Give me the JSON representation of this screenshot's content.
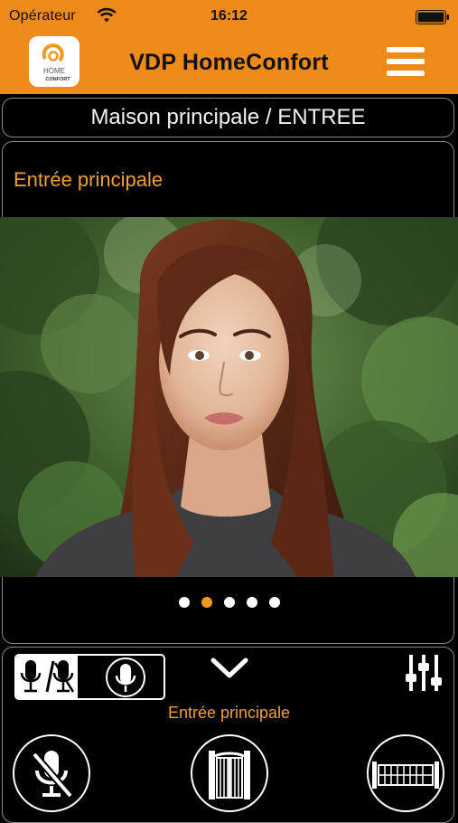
{
  "status_bar": {
    "carrier": "Opérateur",
    "time": "16:12"
  },
  "header": {
    "title": "VDP HomeConfort",
    "logo": {
      "line1": "HOME",
      "line2": "CONFORT"
    },
    "accent_color": "#ee8a1a"
  },
  "location": {
    "path": "Maison principale / ENTREE"
  },
  "camera": {
    "name": "Entrée principale",
    "name_color": "#f0a033",
    "pages": {
      "count": 5,
      "active_index": 1
    }
  },
  "controls": {
    "label": "Entrée principale",
    "icons": {
      "audio_mode": [
        "microphone-icon",
        "microphone-muted-icon",
        "microphone-icon"
      ],
      "collapse": "chevron-down-icon",
      "settings": "sliders-icon",
      "mute": "microphone-muted-icon",
      "gate": "gate-icon",
      "sliding_gate": "sliding-gate-icon"
    }
  }
}
